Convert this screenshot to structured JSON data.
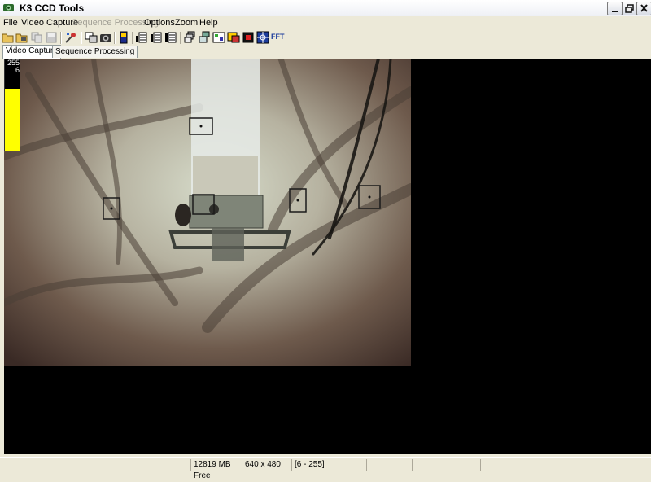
{
  "window": {
    "title": "K3 CCD Tools"
  },
  "menu": [
    {
      "label": "File",
      "enabled": true
    },
    {
      "label": "Video Capture",
      "enabled": true
    },
    {
      "label": "Sequence Processing",
      "enabled": false
    },
    {
      "label": "Options",
      "enabled": true
    },
    {
      "label": "Zoom",
      "enabled": true
    },
    {
      "label": "Help",
      "enabled": true
    }
  ],
  "toolbar": {
    "fft_label": "FFT",
    "icons": [
      "open-icon",
      "open-video-icon",
      "copy-icon",
      "save-icon",
      "settings-icon",
      "capture-window-icon",
      "camera-icon",
      "device-icon",
      "frames-icon",
      "frames-add-icon",
      "film-icon",
      "stack-icon",
      "stack-color-icon",
      "align-icon",
      "calibrate-icon",
      "dark-frame-icon",
      "red-square-icon",
      "grid-icon"
    ]
  },
  "tabs": [
    {
      "label": "Video Capture",
      "active": true
    },
    {
      "label": "Sequence Processing",
      "active": false
    }
  ],
  "level_indicator": {
    "high": "255",
    "low": "6",
    "fill_fraction": 0.68
  },
  "status": {
    "free_space": "12819 MB Free",
    "resolution": "640 x 480",
    "range": "[6 - 255]"
  },
  "colors": {
    "level": "#ffff00",
    "viewport_bg": "#000000",
    "chrome": "#ece9d8"
  }
}
